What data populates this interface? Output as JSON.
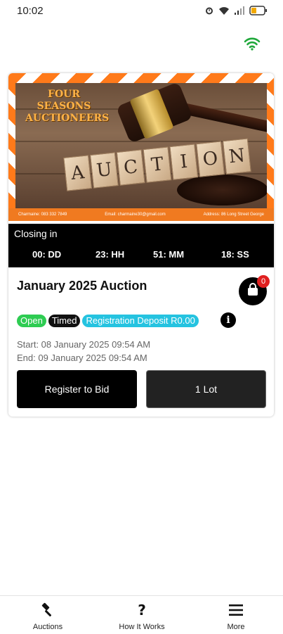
{
  "status_bar": {
    "time": "10:02"
  },
  "banner": {
    "brand": "FOUR SEASONS AUCTIONEERS",
    "blocks": [
      "A",
      "U",
      "C",
      "T",
      "I",
      "O",
      "N"
    ],
    "contact_phone": "Charmaine: 083 332 7849",
    "contact_email": "Email: charmaine30@gmail.com",
    "contact_address": "Address: 86 Long Street George"
  },
  "countdown": {
    "label": "Closing in",
    "days": "00: DD",
    "hours": "23: HH",
    "minutes": "51: MM",
    "seconds": "18: SS"
  },
  "auction": {
    "title": "January 2025 Auction",
    "cart_count": "0",
    "badges": {
      "open": "Open",
      "timed": "Timed",
      "deposit": "Registration Deposit R0.00"
    },
    "start": "Start: 08 January 2025 09:54 AM",
    "end": "End: 09 January 2025 09:54 AM",
    "register_label": "Register to Bid",
    "lots_label": "1 Lot"
  },
  "nav": {
    "auctions": "Auctions",
    "how_it_works": "How It Works",
    "more": "More"
  },
  "colors": {
    "accent_orange": "#f07a20",
    "open_green": "#2ecc52",
    "deposit_cyan": "#25c3e0",
    "wifi_green": "#1fa83a",
    "badge_red": "#e02020"
  }
}
